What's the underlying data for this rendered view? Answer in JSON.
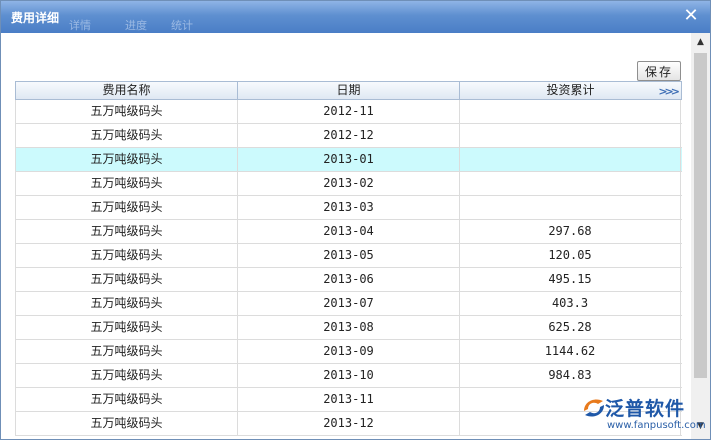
{
  "dialog": {
    "title": "费用详细",
    "ghost_tabs": [
      "详情",
      "进度",
      "统计"
    ],
    "save_label": "保存"
  },
  "grid": {
    "columns": [
      "费用名称",
      "日期",
      "投资累计"
    ],
    "selected_row": 2,
    "rows": [
      {
        "name": "五万吨级码头",
        "date": "2012-11",
        "amount": ""
      },
      {
        "name": "五万吨级码头",
        "date": "2012-12",
        "amount": ""
      },
      {
        "name": "五万吨级码头",
        "date": "2013-01",
        "amount": ""
      },
      {
        "name": "五万吨级码头",
        "date": "2013-02",
        "amount": ""
      },
      {
        "name": "五万吨级码头",
        "date": "2013-03",
        "amount": ""
      },
      {
        "name": "五万吨级码头",
        "date": "2013-04",
        "amount": "297.68"
      },
      {
        "name": "五万吨级码头",
        "date": "2013-05",
        "amount": "120.05"
      },
      {
        "name": "五万吨级码头",
        "date": "2013-06",
        "amount": "495.15"
      },
      {
        "name": "五万吨级码头",
        "date": "2013-07",
        "amount": "403.3"
      },
      {
        "name": "五万吨级码头",
        "date": "2013-08",
        "amount": "625.28"
      },
      {
        "name": "五万吨级码头",
        "date": "2013-09",
        "amount": "1144.62"
      },
      {
        "name": "五万吨级码头",
        "date": "2013-10",
        "amount": "984.83"
      },
      {
        "name": "五万吨级码头",
        "date": "2013-11",
        "amount": ""
      },
      {
        "name": "五万吨级码头",
        "date": "2013-12",
        "amount": ""
      }
    ]
  },
  "watermark": {
    "brand": "泛普软件",
    "url": "www.fanpusoft.com"
  },
  "icons": {
    "close": "close-icon",
    "expand": "double-chevron-right-icon",
    "scroll_up": "scroll-up-arrow-icon",
    "scroll_down": "scroll-down-arrow-icon",
    "logo": "fanpu-logo-icon"
  },
  "colors": {
    "titlebar": "#5e8fd0",
    "selected_row": "#ccfafd",
    "brand": "#1f58a8"
  }
}
